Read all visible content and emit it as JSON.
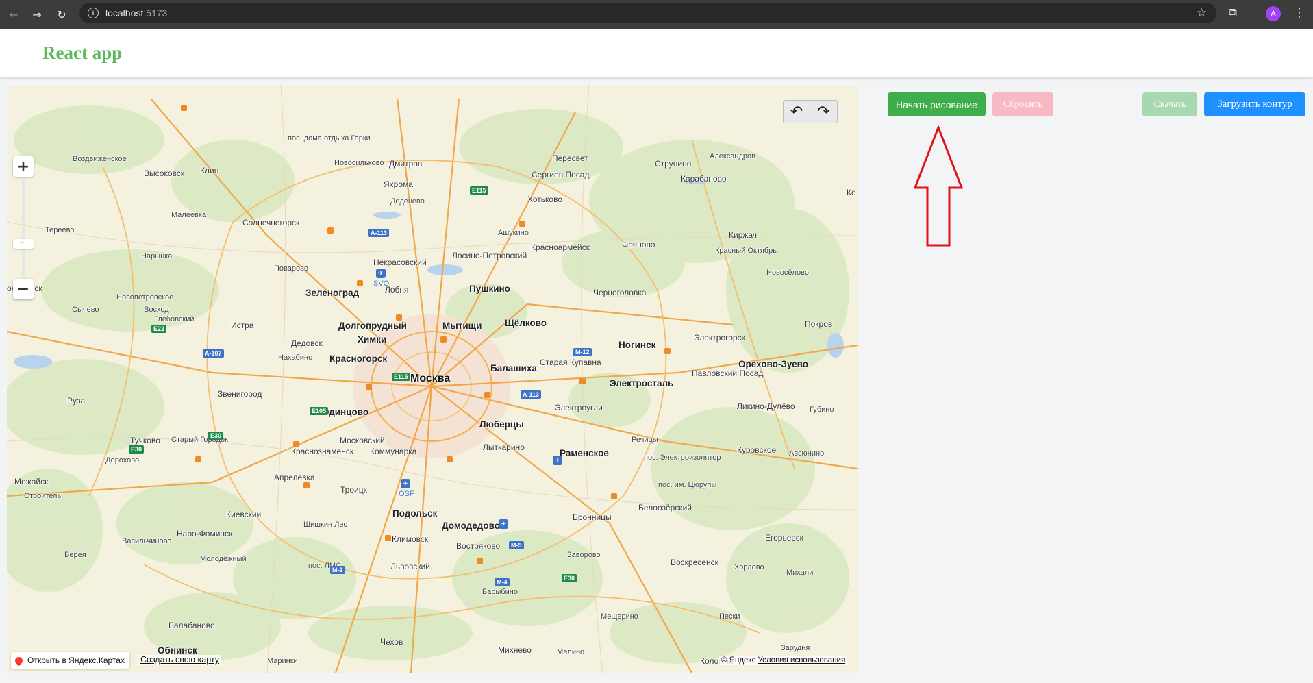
{
  "browser": {
    "url_host": "localhost",
    "url_port": ":5173",
    "profile_initial": "A",
    "info_glyph": "i"
  },
  "app": {
    "title": "React app"
  },
  "map": {
    "places": [
      {
        "name": "Воздвиженское",
        "style": "small"
      },
      {
        "name": "Новосильково",
        "style": "small"
      },
      {
        "name": "Пересвет",
        "style": "normal"
      },
      {
        "name": "Александров",
        "style": "small"
      },
      {
        "name": "Дмитров",
        "style": "normal"
      },
      {
        "name": "Струнино",
        "style": "normal"
      },
      {
        "name": "Клин",
        "style": "normal"
      },
      {
        "name": "Высоковск",
        "style": "normal"
      },
      {
        "name": "Сергиев Посад",
        "style": "normal"
      },
      {
        "name": "Яхрома",
        "style": "normal"
      },
      {
        "name": "Карабаново",
        "style": "normal"
      },
      {
        "name": "Хотьково",
        "style": "normal"
      },
      {
        "name": "Деденево",
        "style": "small"
      },
      {
        "name": "пос. дома отдыха Горки",
        "style": "small"
      },
      {
        "name": "Малеевка",
        "style": "small"
      },
      {
        "name": "Солнечногорск",
        "style": "normal"
      },
      {
        "name": "Тереево",
        "style": "small"
      },
      {
        "name": "Ашукино",
        "style": "small"
      },
      {
        "name": "Киржач",
        "style": "normal"
      },
      {
        "name": "Красноармейск",
        "style": "normal"
      },
      {
        "name": "Фряново",
        "style": "normal"
      },
      {
        "name": "Красный Октябрь",
        "style": "small"
      },
      {
        "name": "Нарынка",
        "style": "small"
      },
      {
        "name": "Некрасовский",
        "style": "normal"
      },
      {
        "name": "Поварово",
        "style": "small"
      },
      {
        "name": "Новосёлово",
        "style": "small"
      },
      {
        "name": "Лобня",
        "style": "normal"
      },
      {
        "name": "Пушкино",
        "style": "bold"
      },
      {
        "name": "Черноголовка",
        "style": "normal"
      },
      {
        "name": "Зеленоград",
        "style": "bold"
      },
      {
        "name": "Новопетровское",
        "style": "small"
      },
      {
        "name": "Сычёво",
        "style": "small"
      },
      {
        "name": "Восход",
        "style": "small"
      },
      {
        "name": "Глебовский",
        "style": "small"
      },
      {
        "name": "Истра",
        "style": "normal"
      },
      {
        "name": "Долгопрудный",
        "style": "bold"
      },
      {
        "name": "Мытищи",
        "style": "bold"
      },
      {
        "name": "Щёлково",
        "style": "bold"
      },
      {
        "name": "Лосино-Петровский",
        "style": "normal"
      },
      {
        "name": "Покров",
        "style": "normal"
      },
      {
        "name": "Электрогорск",
        "style": "normal"
      },
      {
        "name": "Химки",
        "style": "bold"
      },
      {
        "name": "Ногинск",
        "style": "bold"
      },
      {
        "name": "Дедовск",
        "style": "normal"
      },
      {
        "name": "Нахабино",
        "style": "small"
      },
      {
        "name": "Красногорск",
        "style": "bold"
      },
      {
        "name": "Старая Купавна",
        "style": "normal"
      },
      {
        "name": "Балашиха",
        "style": "bold"
      },
      {
        "name": "Орехово-Зуево",
        "style": "bold"
      },
      {
        "name": "Москва",
        "style": "capital"
      },
      {
        "name": "Электросталь",
        "style": "bold"
      },
      {
        "name": "Павловский Посад",
        "style": "normal"
      },
      {
        "name": "Руза",
        "style": "normal"
      },
      {
        "name": "Звенигород",
        "style": "normal"
      },
      {
        "name": "Электроугли",
        "style": "normal"
      },
      {
        "name": "Одинцово",
        "style": "bold"
      },
      {
        "name": "Ликино-Дулёво",
        "style": "normal"
      },
      {
        "name": "Губино",
        "style": "small"
      },
      {
        "name": "Люберцы",
        "style": "bold"
      },
      {
        "name": "Тучково",
        "style": "normal"
      },
      {
        "name": "Старый Городок",
        "style": "small"
      },
      {
        "name": "Московский",
        "style": "normal"
      },
      {
        "name": "Речицы",
        "style": "small"
      },
      {
        "name": "Краснознаменск",
        "style": "normal"
      },
      {
        "name": "Коммунарка",
        "style": "normal"
      },
      {
        "name": "Лыткарино",
        "style": "normal"
      },
      {
        "name": "Раменское",
        "style": "bold"
      },
      {
        "name": "Куровское",
        "style": "normal"
      },
      {
        "name": "Дорохово",
        "style": "small"
      },
      {
        "name": "пос. Электроизолятор",
        "style": "small"
      },
      {
        "name": "Авсюнино",
        "style": "small"
      },
      {
        "name": "Можайск",
        "style": "normal"
      },
      {
        "name": "Апрелевка",
        "style": "normal"
      },
      {
        "name": "Троицк",
        "style": "normal"
      },
      {
        "name": "пос. им. Цюрупы",
        "style": "small"
      },
      {
        "name": "Строитель",
        "style": "small"
      },
      {
        "name": "Киевский",
        "style": "normal"
      },
      {
        "name": "Подольск",
        "style": "bold"
      },
      {
        "name": "Белоозёрский",
        "style": "normal"
      },
      {
        "name": "Бронницы",
        "style": "normal"
      },
      {
        "name": "Шишкин Лес",
        "style": "small"
      },
      {
        "name": "Домодедово",
        "style": "bold"
      },
      {
        "name": "Наро-Фоминск",
        "style": "normal"
      },
      {
        "name": "Васильчиново",
        "style": "small"
      },
      {
        "name": "Климовск",
        "style": "normal"
      },
      {
        "name": "Егорьевск",
        "style": "normal"
      },
      {
        "name": "Востряково",
        "style": "normal"
      },
      {
        "name": "Верея",
        "style": "small"
      },
      {
        "name": "Заворово",
        "style": "small"
      },
      {
        "name": "Молодёжный",
        "style": "small"
      },
      {
        "name": "пос. ЛМС",
        "style": "small"
      },
      {
        "name": "Львовский",
        "style": "normal"
      },
      {
        "name": "Воскресенск",
        "style": "normal"
      },
      {
        "name": "Хорлово",
        "style": "small"
      },
      {
        "name": "Михали",
        "style": "small"
      },
      {
        "name": "Барыбино",
        "style": "small"
      },
      {
        "name": "Мещерино",
        "style": "small"
      },
      {
        "name": "Пески",
        "style": "small"
      },
      {
        "name": "Балабаново",
        "style": "normal"
      },
      {
        "name": "Чехов",
        "style": "normal"
      },
      {
        "name": "Обнинск",
        "style": "bold"
      },
      {
        "name": "Михнево",
        "style": "normal"
      },
      {
        "name": "Малино",
        "style": "small"
      },
      {
        "name": "Зарудня",
        "style": "small"
      },
      {
        "name": "Маринки",
        "style": "small"
      },
      {
        "name": "Коломна",
        "style": "normal"
      },
      {
        "name": "околамск",
        "style": "normal"
      },
      {
        "name": "Ко",
        "style": "normal"
      }
    ],
    "shields": [
      {
        "label": "E115",
        "color": "green"
      },
      {
        "label": "A-113",
        "color": "blue"
      },
      {
        "label": "E22",
        "color": "green"
      },
      {
        "label": "A-107",
        "color": "blue"
      },
      {
        "label": "M-12",
        "color": "blue"
      },
      {
        "label": "E115",
        "color": "green"
      },
      {
        "label": "A-113",
        "color": "blue"
      },
      {
        "label": "E105",
        "color": "green"
      },
      {
        "label": "E30",
        "color": "green"
      },
      {
        "label": "E30",
        "color": "green"
      },
      {
        "label": "M-5",
        "color": "blue"
      },
      {
        "label": "M-2",
        "color": "blue"
      },
      {
        "label": "M-4",
        "color": "blue"
      },
      {
        "label": "E30",
        "color": "green"
      }
    ],
    "airports": [
      "SVO",
      "OSF"
    ],
    "zoom_in_label": "+",
    "zoom_out_label": "−",
    "zoom_handle_label": ":::",
    "undo_icon": "undo-icon",
    "redo_icon": "redo-icon",
    "open_in_yandex_label": "Открыть в Яндекс.Картах",
    "create_map_label": "Создать свою карту",
    "copyright_label": "© Яндекс",
    "terms_label": "Условия использования"
  },
  "controls": {
    "start_drawing_label": "Начать рисование",
    "reset_label": "Сбросить",
    "download_label": "Скачать",
    "upload_label": "Загрузить контур"
  },
  "annotation": {
    "arrow_color": "#e1121b"
  },
  "colors": {
    "title_green": "#5cb85c",
    "start_btn": "#3eae4a",
    "reset_btn": "#f9b9c4",
    "download_btn": "#a8d8af",
    "upload_btn": "#1e90ff",
    "avatar": "#a142f4"
  }
}
